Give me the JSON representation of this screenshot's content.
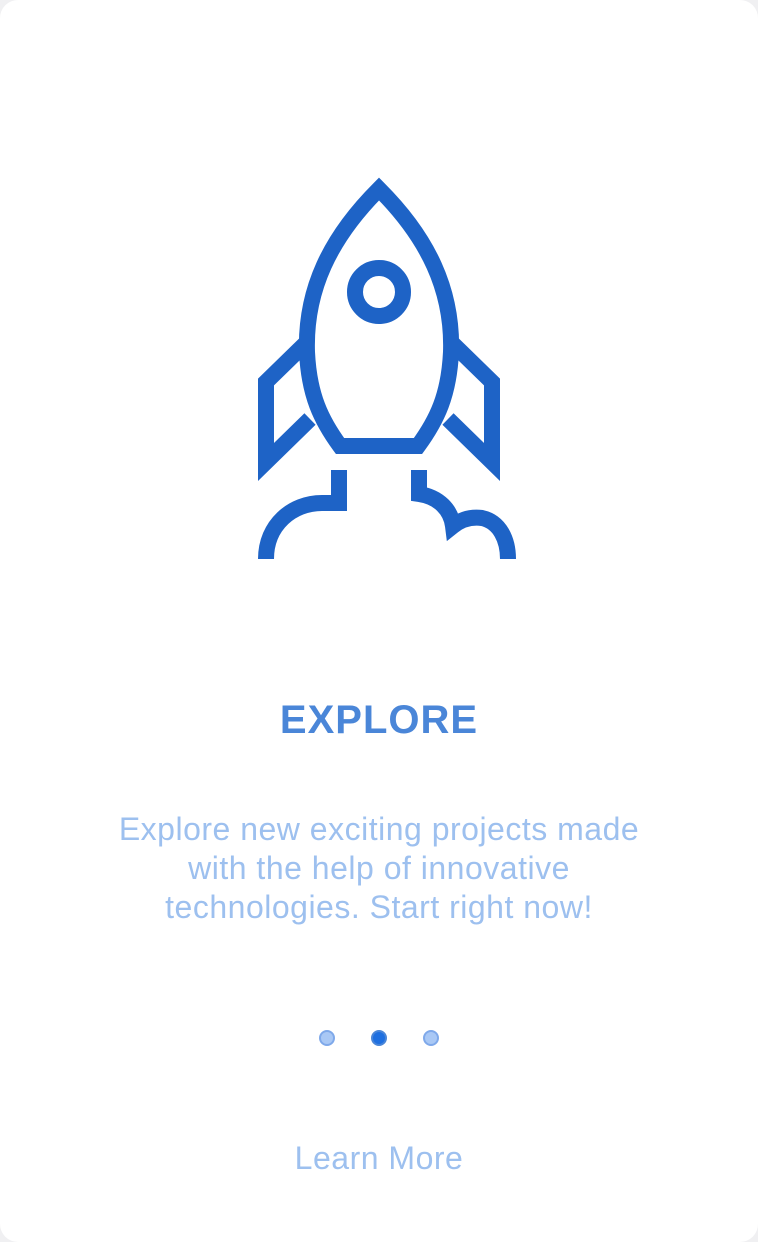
{
  "onboarding": {
    "title": "EXPLORE",
    "description": "Explore new exciting projects made with the help of innovative technologies. Start right now!",
    "learn_more_label": "Learn More",
    "illustration_icon": "rocket-icon",
    "pager": {
      "page_count": 3,
      "active_index": 1
    }
  },
  "colors": {
    "icon_stroke": "#1e63c6",
    "title": "#4a86d8",
    "description": "#9dc0ef",
    "link": "#9dc0ef",
    "dot_active_fill": "#1e6fe0",
    "dot_active_border": "#4a86d8",
    "dot_inactive_fill": "#a9c8f5",
    "dot_inactive_border": "#7fa9ea",
    "card_background": "#ffffff"
  }
}
